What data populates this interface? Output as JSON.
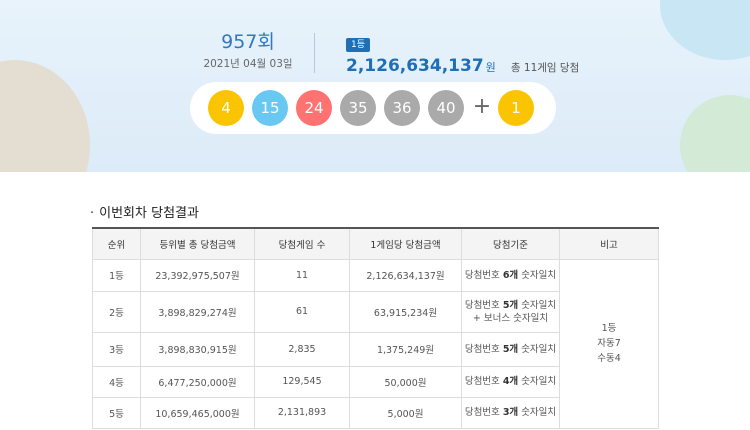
{
  "draw": {
    "round_number": "957",
    "round_suffix": "회",
    "date": "2021년 04월 03일"
  },
  "first_prize": {
    "badge": "1등",
    "amount": "2,126,634,137",
    "unit": "원",
    "winners_text": "총 11게임 당첨"
  },
  "numbers": {
    "main": [
      {
        "value": "4",
        "color": "#fbc400"
      },
      {
        "value": "15",
        "color": "#69c8f2"
      },
      {
        "value": "24",
        "color": "#ff7272"
      },
      {
        "value": "35",
        "color": "#aaaaaa"
      },
      {
        "value": "36",
        "color": "#aaaaaa"
      },
      {
        "value": "40",
        "color": "#aaaaaa"
      }
    ],
    "plus": "+",
    "bonus": {
      "value": "1",
      "color": "#fbc400"
    }
  },
  "section": {
    "bullet": "·",
    "title": "이번회차 당첨결과"
  },
  "table": {
    "headers": [
      "순위",
      "등위별 총 당첨금액",
      "당첨게임 수",
      "1게임당 당첨금액",
      "당첨기준",
      "비고"
    ],
    "rows": [
      {
        "rank": "1등",
        "total": "23,392,975,507원",
        "games": "11",
        "per_game": "2,126,634,137원",
        "criteria_pre": "당첨번호 ",
        "criteria_bold": "6개",
        "criteria_post": " 숫자일치",
        "criteria_extra": ""
      },
      {
        "rank": "2등",
        "total": "3,898,829,274원",
        "games": "61",
        "per_game": "63,915,234원",
        "criteria_pre": "당첨번호 ",
        "criteria_bold": "5개",
        "criteria_post": " 숫자일치",
        "criteria_extra": "+ 보너스 숫자일치"
      },
      {
        "rank": "3등",
        "total": "3,898,830,915원",
        "games": "2,835",
        "per_game": "1,375,249원",
        "criteria_pre": "당첨번호 ",
        "criteria_bold": "5개",
        "criteria_post": " 숫자일치",
        "criteria_extra": ""
      },
      {
        "rank": "4등",
        "total": "6,477,250,000원",
        "games": "129,545",
        "per_game": "50,000원",
        "criteria_pre": "당첨번호 ",
        "criteria_bold": "4개",
        "criteria_post": " 숫자일치",
        "criteria_extra": ""
      },
      {
        "rank": "5등",
        "total": "10,659,465,000원",
        "games": "2,131,893",
        "per_game": "5,000원",
        "criteria_pre": "당첨번호 ",
        "criteria_bold": "3개",
        "criteria_post": " 숫자일치",
        "criteria_extra": ""
      }
    ],
    "note": {
      "line1": "1등",
      "line2": "자동7",
      "line3": "수동4"
    }
  }
}
